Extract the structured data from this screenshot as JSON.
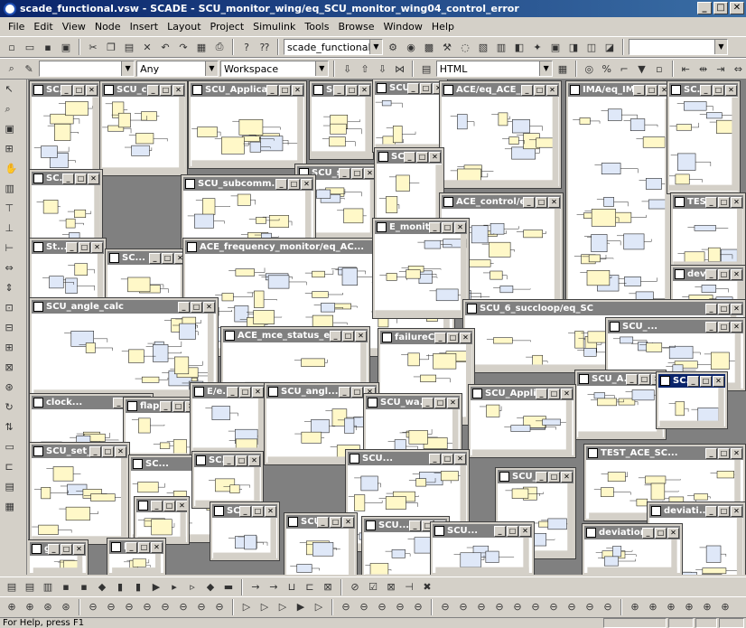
{
  "window": {
    "title": "scade_functional.vsw - SCADE - SCU_monitor_wing/eq_SCU_monitor_wing04_control_error",
    "minimize": "_",
    "maximize": "□",
    "close": "✕"
  },
  "menu": [
    "File",
    "Edit",
    "View",
    "Node",
    "Insert",
    "Layout",
    "Project",
    "Simulink",
    "Tools",
    "Browse",
    "Window",
    "Help"
  ],
  "toolbar1": {
    "project_combo": "scade_functional.etp"
  },
  "toolbar2": {
    "filter_combo": "Any",
    "scope_combo": "Workspace",
    "report_combo": "HTML"
  },
  "children": [
    {
      "title": "SC..."
    },
    {
      "title": "SCU_chec..."
    },
    {
      "title": "SCU_Application..."
    },
    {
      "title": "SC..."
    },
    {
      "title": "SCU..."
    },
    {
      "title": "ACE/eq_ACE_1"
    },
    {
      "title": "IMA/eq_IM..."
    },
    {
      "title": "SC..."
    },
    {
      "title": "SC..."
    },
    {
      "title": "SCU_se..."
    },
    {
      "title": "SC..."
    },
    {
      "title": "SCU_subcomm..."
    },
    {
      "title": "ACE_control/eq_..."
    },
    {
      "title": "TES..."
    },
    {
      "title": "St..."
    },
    {
      "title": "SC..."
    },
    {
      "title": "ACE_frequency_monitor/eq_AC..."
    },
    {
      "title": "E_monito..."
    },
    {
      "title": "dev..."
    },
    {
      "title": "SCU_angle_calc"
    },
    {
      "title": "SCU_6_succloop/eq_SC"
    },
    {
      "title": "SCU_..."
    },
    {
      "title": "ACE_mce_status_eval/e..."
    },
    {
      "title": "failureCo..."
    },
    {
      "title": "SCU_A..."
    },
    {
      "title": "SC..."
    },
    {
      "title": "clock..."
    },
    {
      "title": "flap_c..."
    },
    {
      "title": "E/e..."
    },
    {
      "title": "SCU_angl..."
    },
    {
      "title": "SCU_Applic..."
    },
    {
      "title": "SCU_wa..."
    },
    {
      "title": "SCU_set_p..."
    },
    {
      "title": "SC..."
    },
    {
      "title": "SC..."
    },
    {
      "title": "TEST_ACE_SC..."
    },
    {
      "title": "SCU..."
    },
    {
      "title": "SCU_..."
    },
    {
      "title": "SC..."
    },
    {
      "title": "deviati..."
    },
    {
      "title": "SC..."
    },
    {
      "title": "SCU_s..."
    },
    {
      "title": "SCU..."
    },
    {
      "title": "SCU..."
    },
    {
      "title": "deviation..."
    },
    {
      "title": "gai..."
    },
    {
      "title": "limi..."
    }
  ],
  "status": {
    "text": "For Help, press F1"
  }
}
